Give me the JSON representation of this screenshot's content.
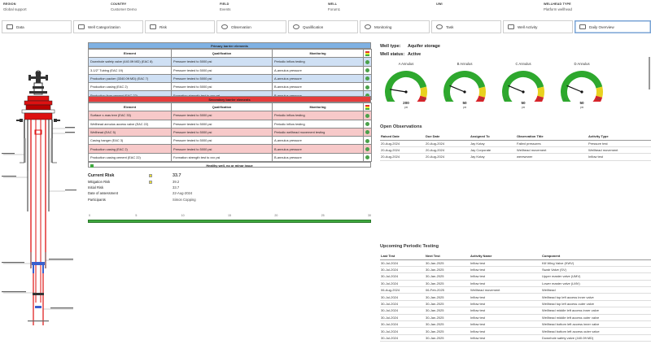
{
  "header": {
    "fields": [
      {
        "label": "REGION",
        "value": "Global support"
      },
      {
        "label": "COUNTRY",
        "value": "Customer Demo"
      },
      {
        "label": "FIELD",
        "value": "Events"
      },
      {
        "label": "WELL",
        "value": "Forum1"
      },
      {
        "label": "UWI",
        "value": ""
      },
      {
        "label": "WELLHEAD TYPE",
        "value": "Platform wellhead"
      }
    ]
  },
  "tabs": [
    {
      "label": "Data",
      "icon": "data-icon"
    },
    {
      "label": "Well Categorization",
      "icon": "categorization-icon"
    },
    {
      "label": "Risk",
      "icon": "risk-icon"
    },
    {
      "label": "Observation",
      "icon": "observation-icon"
    },
    {
      "label": "Qualification",
      "icon": "qualification-icon"
    },
    {
      "label": "Monitoring",
      "icon": "monitoring-icon"
    },
    {
      "label": "Task",
      "icon": "task-icon"
    },
    {
      "label": "Well Activity",
      "icon": "activity-icon"
    },
    {
      "label": "Daily Overview",
      "icon": "overview-icon"
    }
  ],
  "colors": {
    "primary_header": "#7fb1e3",
    "primary_row": "#cfe0f4",
    "secondary_header": "#e53c3c",
    "secondary_row": "#f7c9c9",
    "status_green": "#4aa14a",
    "gauge_green": "#2ea82e",
    "gauge_yellow": "#e8d21f",
    "gauge_red": "#d8232a"
  },
  "primary_barrier": {
    "title": "Primary barrier elements",
    "columns": [
      "Element",
      "Qualification",
      "Monitoring"
    ],
    "rows": [
      [
        "Downhole safety valve (440.0ft MD) (EAC 8)",
        "Pressure tested to 5000 psi",
        "Periodic inflow testing"
      ],
      [
        "3-1/2\" Tubing (EAC 19)",
        "Pressure tested to 5000 psi",
        "A-annulus pressure"
      ],
      [
        "Production packer (3340.0ft MD) (EAC 7)",
        "Pressure tested to 5000 psi",
        "A-annulus pressure"
      ],
      [
        "Production casing (EAC 2)",
        "Pressure tested to 5000 psi",
        "B-annulus pressure"
      ],
      [
        "Production liner cement (EAC 22)",
        "Formation strength test to xxx psi",
        "B-annulus pressure"
      ]
    ]
  },
  "secondary_barrier": {
    "title": "Secondary barrier elements",
    "columns": [
      "Element",
      "Qualification",
      "Monitoring"
    ],
    "rows": [
      [
        "Surface x-mas tree (EAC 33)",
        "Pressure tested to 5000 psi",
        "Periodic inflow testing"
      ],
      [
        "Wellhead annulus access valve (EAC 22)",
        "Pressure tested to 5000 psi",
        "Periodic inflow testing"
      ],
      [
        "Wellhead (EAC 5)",
        "Pressure tested to 5000 psi",
        "Periodic wellhead movement testing"
      ],
      [
        "Casing hanger (EAC 3)",
        "Pressure tested to 5000 psi",
        "A-annulus pressure"
      ],
      [
        "Production casing (EAC 2)",
        "Pressure tested to 5000 psi",
        "B-annulus pressure"
      ],
      [
        "Production casing cement (EAC 22)",
        "Formation strength test to xxx psi",
        "B-annulus pressure"
      ]
    ],
    "footer": "Healthy well, no or minor issue"
  },
  "risk": {
    "current_label": "Current Risk",
    "current_value": "33.7",
    "mitigation_label": "Mitigation Risk",
    "mitigation_value": "39.2",
    "initial_label": "Initial Risk",
    "initial_value": "33.7",
    "date_label": "Date of assessment",
    "date_value": "22-Aug-2024",
    "participants_label": "Participants",
    "participants_value": "Simon Copping",
    "scale_ticks": [
      "0",
      "5",
      "10",
      "15",
      "20",
      "25",
      "30"
    ]
  },
  "well": {
    "type_label": "Well type:",
    "type_value": "Aquifer storage",
    "status_label": "Well status:",
    "status_value": "Active"
  },
  "gauges": [
    {
      "title": "A Annulus",
      "value": 200,
      "value_label": "200",
      "unit": "psi",
      "min": "0",
      "max": "1000",
      "fraction": 0.2
    },
    {
      "title": "B Annulus",
      "value": 50,
      "value_label": "50",
      "unit": "psi",
      "min": "0",
      "max": "200",
      "fraction": 0.25
    },
    {
      "title": "C Annulus",
      "value": 50,
      "value_label": "50",
      "unit": "psi",
      "min": "0",
      "max": "200",
      "fraction": 0.25
    },
    {
      "title": "D Annulus",
      "value": 50,
      "value_label": "50",
      "unit": "psi",
      "min": "0",
      "max": "200",
      "fraction": 0.25
    }
  ],
  "observations": {
    "title": "Open Observations",
    "columns": [
      "Raised Date",
      "Due Date",
      "Assigned To",
      "Observation Title",
      "Activity Type"
    ],
    "rows": [
      [
        "20-Aug-2024",
        "20-Aug-2024",
        "Jay Kotay",
        "Failed pressures",
        "Pressure test"
      ],
      [
        "20-Aug-2024",
        "20-Aug-2024",
        "Jay Corporate",
        "Wellhead movement",
        "Wellhead movement"
      ],
      [
        "20-Aug-2024",
        "20-Aug-2024",
        "Jay Kotay",
        "werewrwer",
        "Inflow test"
      ]
    ]
  },
  "periodic": {
    "title": "Upcoming Periodic Testing",
    "columns": [
      "Last Test",
      "Next Test",
      "Activity Name",
      "Component"
    ],
    "rows": [
      [
        "30-Jul-2024",
        "30-Jan-2025",
        "Inflow test",
        "Kill Wing Valve (KWV)"
      ],
      [
        "30-Jul-2024",
        "30-Jan-2025",
        "Inflow test",
        "Swab Valve (SV)"
      ],
      [
        "30-Jul-2024",
        "30-Jan-2025",
        "Inflow test",
        "Upper master valve (UMV)"
      ],
      [
        "30-Jul-2024",
        "30-Jan-2025",
        "Inflow test",
        "Lower master valve (LMV)"
      ],
      [
        "06-Aug-2024",
        "06-Feb-2025",
        "Wellhead movement",
        "Wellhead"
      ],
      [
        "30-Jul-2024",
        "30-Jan-2025",
        "Inflow test",
        "Wellhead top left access inner valve"
      ],
      [
        "30-Jul-2024",
        "30-Jan-2025",
        "Inflow test",
        "Wellhead top left access outer valve"
      ],
      [
        "30-Jul-2024",
        "30-Jan-2025",
        "Inflow test",
        "Wellhead middle left access inner valve"
      ],
      [
        "30-Jul-2024",
        "30-Jan-2025",
        "Inflow test",
        "Wellhead middle left access outer valve"
      ],
      [
        "30-Jul-2024",
        "30-Jan-2025",
        "Inflow test",
        "Wellhead bottom left access inner valve"
      ],
      [
        "30-Jul-2024",
        "30-Jan-2025",
        "Inflow test",
        "Wellhead bottom left access outer valve"
      ],
      [
        "30-Jul-2024",
        "30-Jan-2025",
        "Inflow test",
        "Downhole safety valve (440.0ft MD)"
      ]
    ]
  }
}
